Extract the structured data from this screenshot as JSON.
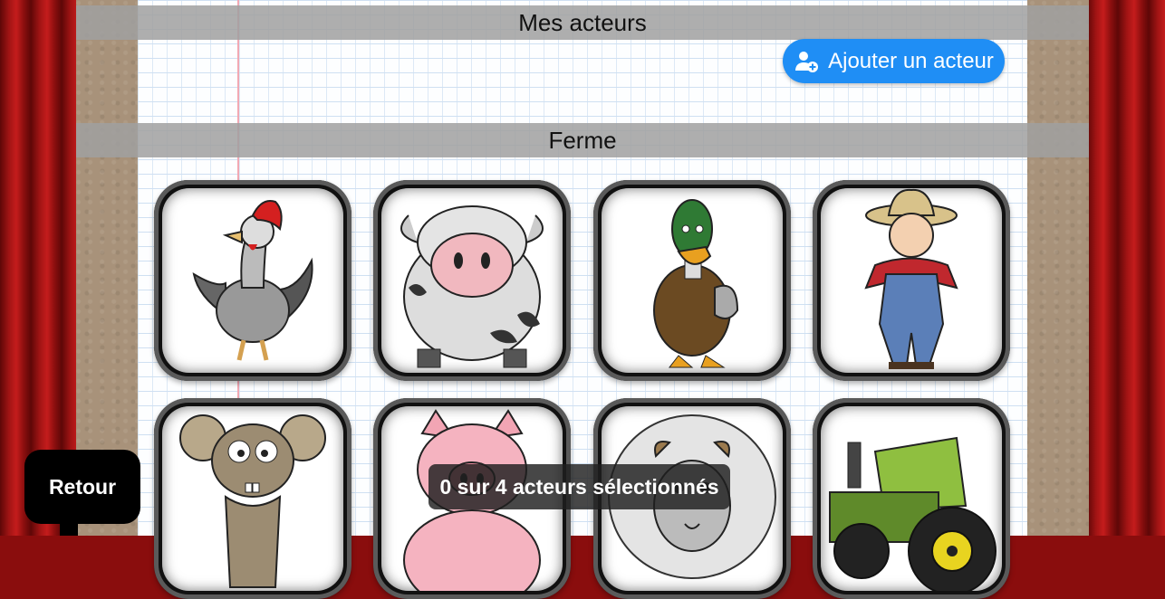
{
  "sections": {
    "my_actors_title": "Mes acteurs",
    "farm_title": "Ferme"
  },
  "add_actor_button": {
    "label": "Ajouter un acteur",
    "icon": "add-user-icon",
    "color": "#1f8ef5"
  },
  "actors": [
    {
      "name": "rooster",
      "icon": "rooster-illustration"
    },
    {
      "name": "cow",
      "icon": "cow-illustration"
    },
    {
      "name": "duck",
      "icon": "duck-illustration"
    },
    {
      "name": "farmer",
      "icon": "farmer-illustration"
    },
    {
      "name": "mouse",
      "icon": "mouse-illustration"
    },
    {
      "name": "pig",
      "icon": "pig-illustration"
    },
    {
      "name": "sheep",
      "icon": "sheep-illustration"
    },
    {
      "name": "tractor",
      "icon": "tractor-illustration"
    }
  ],
  "back_button": {
    "label": "Retour"
  },
  "selection_status": "0 sur 4 acteurs sélectionnés"
}
